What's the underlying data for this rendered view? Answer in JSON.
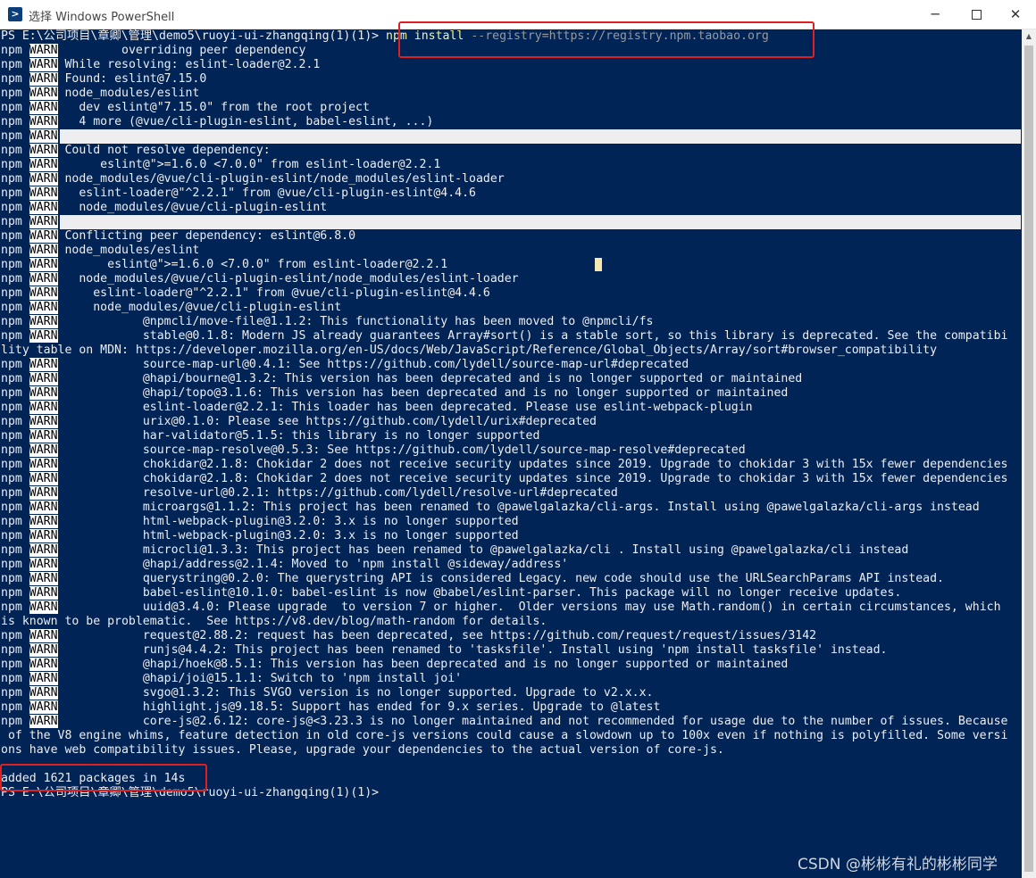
{
  "window": {
    "title": "选择 Windows PowerShell",
    "minimize_label": "─",
    "close_label": "✕"
  },
  "console": {
    "prompt_command": "PS E:\\公司项目\\章卿\\管理\\demo5\\ruoyi-ui-zhangqing(1)(1)> ",
    "command": "npm install",
    "command_args": " --registry=https://registry.npm.taobao.org",
    "lines": [
      {
        "npm": "npm",
        "warn": "WARN",
        "text": "         overriding peer dependency"
      },
      {
        "npm": "npm",
        "warn": "WARN",
        "text": " While resolving: eslint-loader@2.2.1"
      },
      {
        "npm": "npm",
        "warn": "WARN",
        "text": " Found: eslint@7.15.0"
      },
      {
        "npm": "npm",
        "warn": "WARN",
        "text": " node_modules/eslint"
      },
      {
        "npm": "npm",
        "warn": "WARN",
        "text": "   dev eslint@\"7.15.0\" from the root project"
      },
      {
        "npm": "npm",
        "warn": "WARN",
        "text": "   4 more (@vue/cli-plugin-eslint, babel-eslint, ...)"
      },
      {
        "npm": "npm",
        "warn": "WARN",
        "text": "",
        "blank": true
      },
      {
        "npm": "npm",
        "warn": "WARN",
        "text": " Could not resolve dependency:"
      },
      {
        "npm": "npm",
        "warn": "WARN",
        "text": "      eslint@\">=1.6.0 <7.0.0\" from eslint-loader@2.2.1"
      },
      {
        "npm": "npm",
        "warn": "WARN",
        "text": " node_modules/@vue/cli-plugin-eslint/node_modules/eslint-loader"
      },
      {
        "npm": "npm",
        "warn": "WARN",
        "text": "   eslint-loader@\"^2.2.1\" from @vue/cli-plugin-eslint@4.4.6"
      },
      {
        "npm": "npm",
        "warn": "WARN",
        "text": "   node_modules/@vue/cli-plugin-eslint"
      },
      {
        "npm": "npm",
        "warn": "WARN",
        "text": "",
        "blank": true
      },
      {
        "npm": "npm",
        "warn": "WARN",
        "text": " Conflicting peer dependency: eslint@6.8.0"
      },
      {
        "npm": "npm",
        "warn": "WARN",
        "text": " node_modules/eslint"
      },
      {
        "npm": "npm",
        "warn": "WARN",
        "text": "       eslint@\">=1.6.0 <7.0.0\" from eslint-loader@2.2.1"
      },
      {
        "npm": "npm",
        "warn": "WARN",
        "text": "   node_modules/@vue/cli-plugin-eslint/node_modules/eslint-loader"
      },
      {
        "npm": "npm",
        "warn": "WARN",
        "text": "     eslint-loader@\"^2.2.1\" from @vue/cli-plugin-eslint@4.4.6"
      },
      {
        "npm": "npm",
        "warn": "WARN",
        "text": "     node_modules/@vue/cli-plugin-eslint"
      },
      {
        "npm": "npm",
        "warn": "WARN",
        "text": "            @npmcli/move-file@1.1.2: This functionality has been moved to @npmcli/fs"
      },
      {
        "npm": "npm",
        "warn": "WARN",
        "text": "            stable@0.1.8: Modern JS already guarantees Array#sort() is a stable sort, so this library is deprecated. See the compatibi"
      },
      {
        "npm": "",
        "warn": "",
        "text": "lity table on MDN: https://developer.mozilla.org/en-US/docs/Web/JavaScript/Reference/Global_Objects/Array/sort#browser_compatibility"
      },
      {
        "npm": "npm",
        "warn": "WARN",
        "text": "            source-map-url@0.4.1: See https://github.com/lydell/source-map-url#deprecated"
      },
      {
        "npm": "npm",
        "warn": "WARN",
        "text": "            @hapi/bourne@1.3.2: This version has been deprecated and is no longer supported or maintained"
      },
      {
        "npm": "npm",
        "warn": "WARN",
        "text": "            @hapi/topo@3.1.6: This version has been deprecated and is no longer supported or maintained"
      },
      {
        "npm": "npm",
        "warn": "WARN",
        "text": "            eslint-loader@2.2.1: This loader has been deprecated. Please use eslint-webpack-plugin"
      },
      {
        "npm": "npm",
        "warn": "WARN",
        "text": "            urix@0.1.0: Please see https://github.com/lydell/urix#deprecated"
      },
      {
        "npm": "npm",
        "warn": "WARN",
        "text": "            har-validator@5.1.5: this library is no longer supported"
      },
      {
        "npm": "npm",
        "warn": "WARN",
        "text": "            source-map-resolve@0.5.3: See https://github.com/lydell/source-map-resolve#deprecated"
      },
      {
        "npm": "npm",
        "warn": "WARN",
        "text": "            chokidar@2.1.8: Chokidar 2 does not receive security updates since 2019. Upgrade to chokidar 3 with 15x fewer dependencies"
      },
      {
        "npm": "npm",
        "warn": "WARN",
        "text": "            chokidar@2.1.8: Chokidar 2 does not receive security updates since 2019. Upgrade to chokidar 3 with 15x fewer dependencies"
      },
      {
        "npm": "npm",
        "warn": "WARN",
        "text": "            resolve-url@0.2.1: https://github.com/lydell/resolve-url#deprecated"
      },
      {
        "npm": "npm",
        "warn": "WARN",
        "text": "            microargs@1.1.2: This project has been renamed to @pawelgalazka/cli-args. Install using @pawelgalazka/cli-args instead"
      },
      {
        "npm": "npm",
        "warn": "WARN",
        "text": "            html-webpack-plugin@3.2.0: 3.x is no longer supported"
      },
      {
        "npm": "npm",
        "warn": "WARN",
        "text": "            html-webpack-plugin@3.2.0: 3.x is no longer supported"
      },
      {
        "npm": "npm",
        "warn": "WARN",
        "text": "            microcli@1.3.3: This project has been renamed to @pawelgalazka/cli . Install using @pawelgalazka/cli instead"
      },
      {
        "npm": "npm",
        "warn": "WARN",
        "text": "            @hapi/address@2.1.4: Moved to 'npm install @sideway/address'"
      },
      {
        "npm": "npm",
        "warn": "WARN",
        "text": "            querystring@0.2.0: The querystring API is considered Legacy. new code should use the URLSearchParams API instead."
      },
      {
        "npm": "npm",
        "warn": "WARN",
        "text": "            babel-eslint@10.1.0: babel-eslint is now @babel/eslint-parser. This package will no longer receive updates."
      },
      {
        "npm": "npm",
        "warn": "WARN",
        "text": "            uuid@3.4.0: Please upgrade  to version 7 or higher.  Older versions may use Math.random() in certain circumstances, which"
      },
      {
        "npm": "",
        "warn": "",
        "text": "is known to be problematic.  See https://v8.dev/blog/math-random for details."
      },
      {
        "npm": "npm",
        "warn": "WARN",
        "text": "            request@2.88.2: request has been deprecated, see https://github.com/request/request/issues/3142"
      },
      {
        "npm": "npm",
        "warn": "WARN",
        "text": "            runjs@4.4.2: This project has been renamed to 'tasksfile'. Install using 'npm install tasksfile' instead."
      },
      {
        "npm": "npm",
        "warn": "WARN",
        "text": "            @hapi/hoek@8.5.1: This version has been deprecated and is no longer supported or maintained"
      },
      {
        "npm": "npm",
        "warn": "WARN",
        "text": "            @hapi/joi@15.1.1: Switch to 'npm install joi'"
      },
      {
        "npm": "npm",
        "warn": "WARN",
        "text": "            svgo@1.3.2: This SVGO version is no longer supported. Upgrade to v2.x.x."
      },
      {
        "npm": "npm",
        "warn": "WARN",
        "text": "            highlight.js@9.18.5: Support has ended for 9.x series. Upgrade to @latest"
      },
      {
        "npm": "npm",
        "warn": "WARN",
        "text": "            core-js@2.6.12: core-js@<3.23.3 is no longer maintained and not recommended for usage due to the number of issues. Because"
      },
      {
        "npm": "",
        "warn": "",
        "text": " of the V8 engine whims, feature detection in old core-js versions could cause a slowdown up to 100x even if nothing is polyfilled. Some versi"
      },
      {
        "npm": "",
        "warn": "",
        "text": "ons have web compatibility issues. Please, upgrade your dependencies to the actual version of core-js."
      },
      {
        "npm": "",
        "warn": "",
        "text": ""
      },
      {
        "npm": "",
        "warn": "",
        "text": "added 1621 packages in 14s"
      },
      {
        "npm": "",
        "warn": "",
        "text": "PS E:\\公司项目\\章卿\\管理\\demo5\\ruoyi-ui-zhangqing(1)(1)>"
      }
    ]
  },
  "watermark": "CSDN @彬彬有礼的彬彬同学",
  "colors": {
    "console_bg": "#012456",
    "console_fg": "#eeedf0",
    "highlight_border": "#e02020"
  }
}
